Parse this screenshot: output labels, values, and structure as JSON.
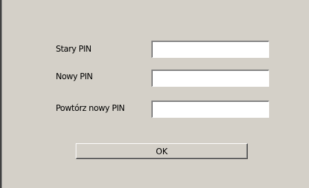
{
  "form": {
    "old_pin_label": "Stary PIN",
    "old_pin_value": "",
    "new_pin_label": "Nowy PIN",
    "new_pin_value": "",
    "repeat_pin_label": "Powtórz nowy PIN",
    "repeat_pin_value": ""
  },
  "actions": {
    "ok_label": "OK"
  },
  "colors": {
    "dialog_background": "#d4d0c8",
    "input_background": "#ffffff"
  }
}
